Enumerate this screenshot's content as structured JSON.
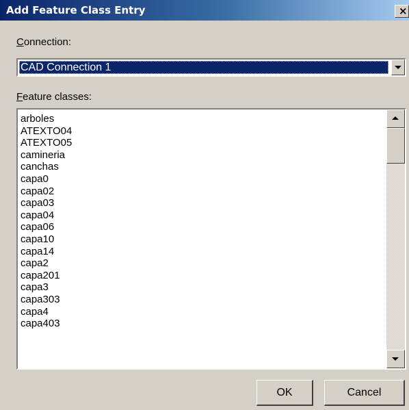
{
  "window": {
    "title": "Add Feature Class Entry",
    "close_glyph": "×"
  },
  "connection": {
    "label_mnemonic": "C",
    "label_rest": "onnection:",
    "selected_value": "CAD Connection 1"
  },
  "feature_classes": {
    "label_mnemonic": "F",
    "label_rest": "eature classes:",
    "items": [
      "arboles",
      "ATEXTO04",
      "ATEXTO05",
      "camineria",
      "canchas",
      "capa0",
      "capa02",
      "capa03",
      "capa04",
      "capa06",
      "capa10",
      "capa14",
      "capa2",
      "capa201",
      "capa3",
      "capa303",
      "capa4",
      "capa403"
    ]
  },
  "buttons": {
    "ok_label": "OK",
    "cancel_label": "Cancel"
  },
  "icons": {
    "close": "close-icon",
    "dropdown": "chevron-down-icon",
    "scroll_up": "scroll-up-arrow-icon",
    "scroll_down": "scroll-down-arrow-icon"
  },
  "colors": {
    "titlebar_start": "#0a246a",
    "titlebar_end": "#a6caf0",
    "selection": "#0a246a",
    "face": "#d4d0c8"
  }
}
